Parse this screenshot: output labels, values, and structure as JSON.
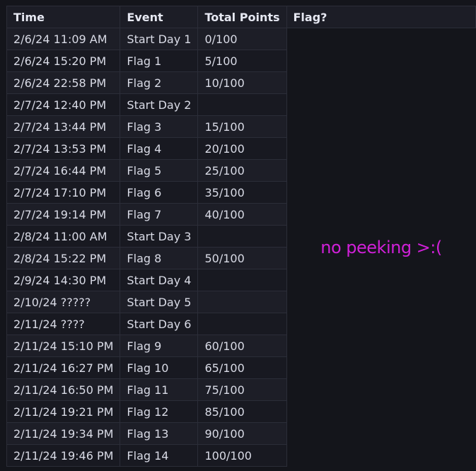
{
  "table": {
    "headers": [
      "Time",
      "Event",
      "Total Points",
      "Flag?"
    ],
    "rows": [
      {
        "time": "2/6/24 11:09 AM",
        "event": "Start Day 1",
        "points": "0/100"
      },
      {
        "time": "2/6/24 15:20 PM",
        "event": "Flag 1",
        "points": "5/100"
      },
      {
        "time": "2/6/24 22:58 PM",
        "event": "Flag 2",
        "points": "10/100"
      },
      {
        "time": "2/7/24 12:40 PM",
        "event": "Start Day 2",
        "points": ""
      },
      {
        "time": "2/7/24 13:44 PM",
        "event": "Flag 3",
        "points": "15/100"
      },
      {
        "time": "2/7/24 13:53 PM",
        "event": "Flag 4",
        "points": "20/100"
      },
      {
        "time": "2/7/24 16:44 PM",
        "event": "Flag 5",
        "points": "25/100"
      },
      {
        "time": "2/7/24 17:10 PM",
        "event": "Flag 6",
        "points": "35/100"
      },
      {
        "time": "2/7/24 19:14 PM",
        "event": "Flag 7",
        "points": "40/100"
      },
      {
        "time": "2/8/24 11:00 AM",
        "event": "Start Day 3",
        "points": ""
      },
      {
        "time": "2/8/24 15:22 PM",
        "event": "Flag 8",
        "points": "50/100"
      },
      {
        "time": "2/9/24 14:30 PM",
        "event": "Start Day 4",
        "points": ""
      },
      {
        "time": "2/10/24 ?????",
        "event": "Start Day 5",
        "points": ""
      },
      {
        "time": "2/11/24 ????",
        "event": "Start Day 6",
        "points": ""
      },
      {
        "time": "2/11/24 15:10 PM",
        "event": "Flag 9",
        "points": "60/100"
      },
      {
        "time": "2/11/24 16:27 PM",
        "event": "Flag 10",
        "points": "65/100"
      },
      {
        "time": "2/11/24 16:50 PM",
        "event": "Flag 11",
        "points": "75/100"
      },
      {
        "time": "2/11/24 19:21 PM",
        "event": "Flag 12",
        "points": "85/100"
      },
      {
        "time": "2/11/24 19:34 PM",
        "event": "Flag 13",
        "points": "90/100"
      },
      {
        "time": "2/11/24 19:46 PM",
        "event": "Flag 14",
        "points": "100/100"
      }
    ],
    "flag_message": "no peeking >:("
  },
  "colors": {
    "background": "#14151b",
    "message": "#d020d8"
  }
}
